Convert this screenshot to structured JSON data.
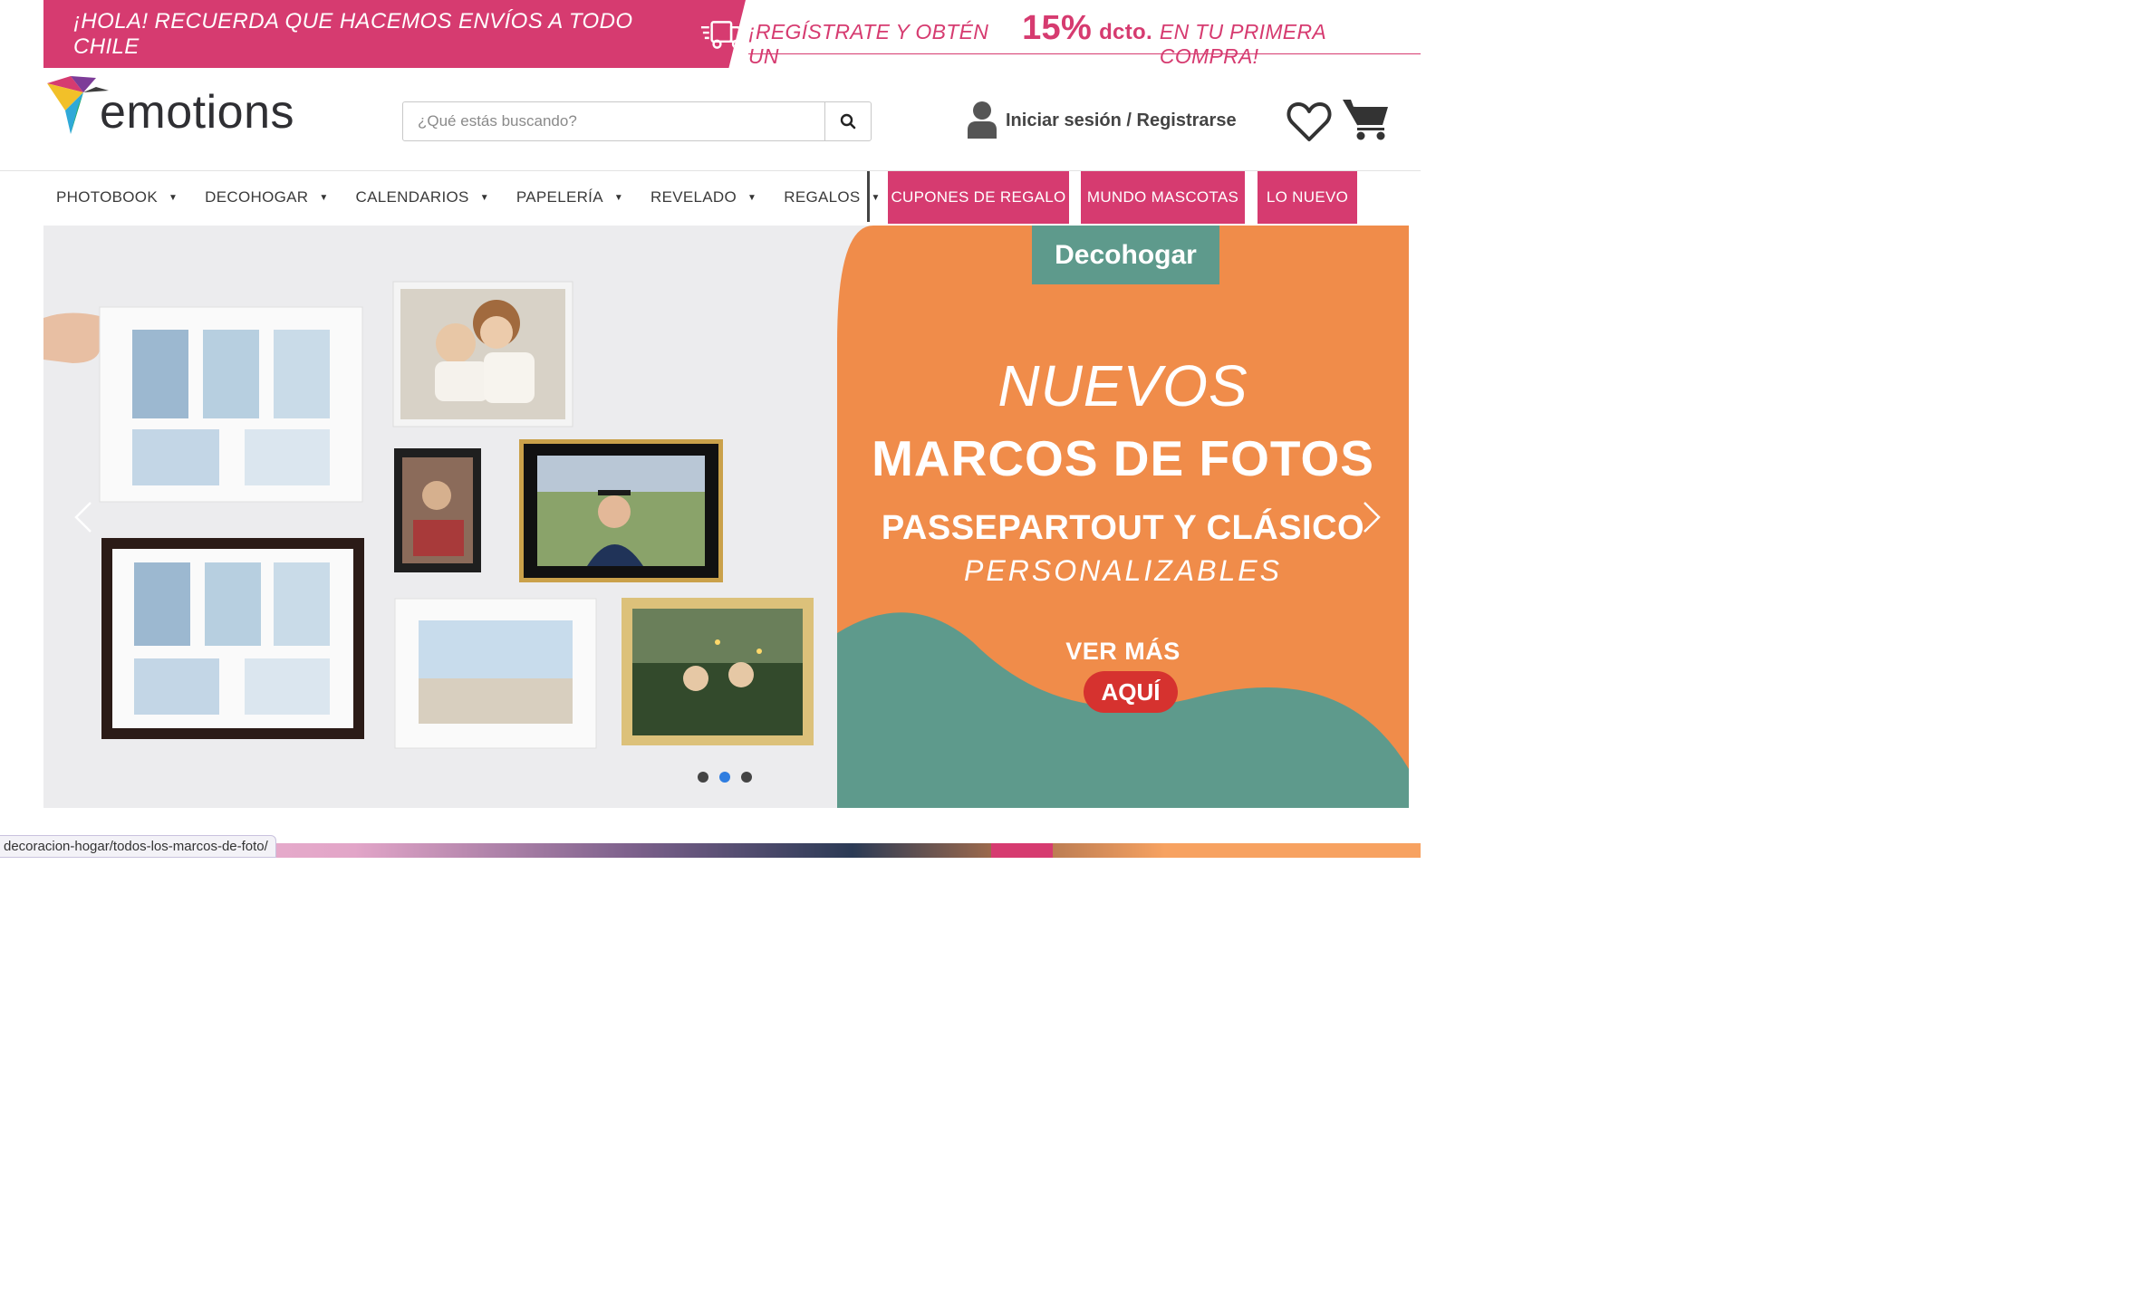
{
  "promo": {
    "left_text": "¡HOLA! RECUERDA QUE HACEMOS ENVÍOS A TODO CHILE",
    "right_prefix": "¡REGÍSTRATE Y OBTÉN UN",
    "right_pct": "15%",
    "right_dcto": "dcto.",
    "right_suffix": "EN TU PRIMERA COMPRA!",
    "brand_color": "#d63b70"
  },
  "header": {
    "logo_text": "emotions",
    "search_placeholder": "¿Qué estás buscando?",
    "account_label": "Iniciar sesión / Registrarse",
    "icons": [
      "user-icon",
      "heart-icon",
      "cart-icon",
      "search-icon",
      "truck-icon"
    ]
  },
  "nav": {
    "items": [
      {
        "label": "PHOTOBOOK"
      },
      {
        "label": "DECOHOGAR"
      },
      {
        "label": "CALENDARIOS"
      },
      {
        "label": "PAPELERÍA"
      },
      {
        "label": "REVELADO"
      },
      {
        "label": "REGALOS"
      }
    ],
    "pills": [
      {
        "label": "CUPONES DE REGALO"
      },
      {
        "label": "MUNDO MASCOTAS"
      },
      {
        "label": "LO NUEVO"
      }
    ]
  },
  "hero": {
    "tag": "Decohogar",
    "line1": "NUEVOS",
    "line2": "MARCOS DE FOTOS",
    "line3": "PASSEPARTOUT Y CLÁSICO",
    "line4": "PERSONALIZABLES",
    "line5": "VER MÁS",
    "cta": "AQUÍ",
    "colors": {
      "orange": "#f08c4a",
      "teal": "#5e9a8c",
      "cta": "#d6322f"
    },
    "active_slide": 2,
    "slide_count": 3
  },
  "status": {
    "url": "decoracion-hogar/todos-los-marcos-de-foto/"
  }
}
